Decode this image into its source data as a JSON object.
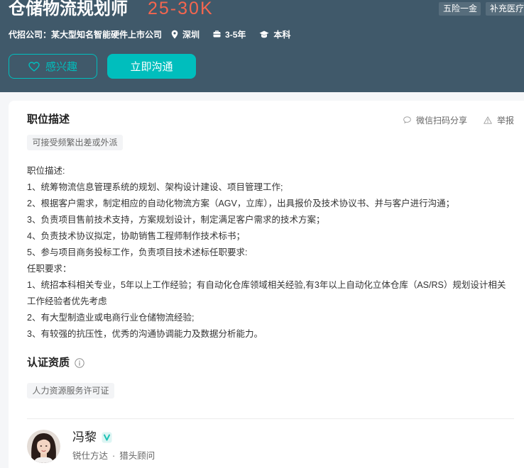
{
  "colors": {
    "header_bg": "#40596a",
    "accent": "#00bebd",
    "salary": "#f4664f",
    "page_bg": "#f5f6f8"
  },
  "header": {
    "title": "仓储物流规划师",
    "salary": "25-30K",
    "benefits": [
      "五险一金",
      "补充医疗"
    ],
    "agent_label": "代招公司：",
    "client_company": "某大型知名智能硬件上市公司",
    "location": "深圳",
    "experience": "3-5年",
    "education": "本科",
    "interest_button": "感兴趣",
    "chat_button": "立即沟通"
  },
  "job_description": {
    "heading": "职位描述",
    "share_label": "微信扫码分享",
    "report_label": "举报",
    "tags": [
      "可接受频繁出差或外派"
    ],
    "lines": [
      "职位描述:",
      "1、统筹物流信息管理系统的规划、架构设计建设、项目管理工作;",
      "2、根据客户需求，制定相应的自动化物流方案（AGV，立库），出具报价及技术协议书、并与客户进行沟通；",
      "3、负责项目售前技术支持，方案规划设计，制定满足客户需求的技术方案；",
      "4、负责技术协议拟定，协助销售工程师制作技术标书；",
      "5、参与项目商务投标工作，负责项目技术述标任职要求:",
      "任职要求：",
      "1、统招本科相关专业，5年以上工作经验；有自动化仓库领域相关经验,有3年以上自动化立体仓库（AS/RS）规划设计相关工作经验者优先考虑",
      "2、有大型制造业或电商行业仓储物流经验;",
      "3、有较强的抗压性，优秀的沟通协调能力及数据分析能力。"
    ]
  },
  "certification": {
    "heading": "认证资质",
    "tags": [
      "人力资源服务许可证"
    ]
  },
  "recruiter": {
    "name": "冯黎",
    "company": "锐仕方达",
    "separator": "·",
    "title": "猎头顾问"
  },
  "icons": {
    "location": "location-pin-icon",
    "experience": "briefcase-icon",
    "education": "graduation-cap-icon",
    "interest": "heart-icon",
    "share": "chat-bubble-icon",
    "report": "warning-triangle-icon",
    "certification_info": "info-circle-icon",
    "verified": "verified-badge-icon"
  }
}
